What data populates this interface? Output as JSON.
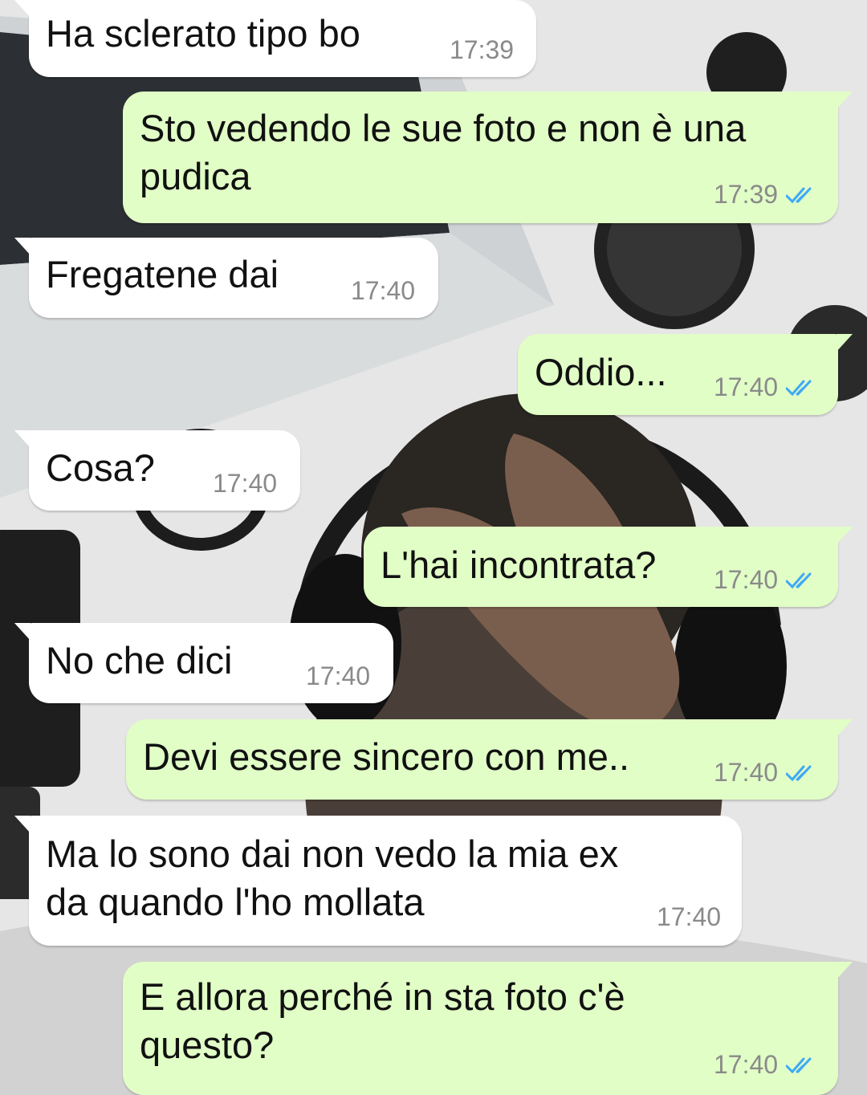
{
  "chat": {
    "messages": [
      {
        "direction": "incoming",
        "text": "Ha sclerato tipo bo",
        "time": "17:39"
      },
      {
        "direction": "outgoing",
        "text": "Sto vedendo le sue foto e non è una\npudica",
        "time": "17:39",
        "read": true
      },
      {
        "direction": "incoming",
        "text": "Fregatene dai",
        "time": "17:40"
      },
      {
        "direction": "outgoing",
        "text": "Oddio...",
        "time": "17:40",
        "read": true
      },
      {
        "direction": "incoming",
        "text": "Cosa?",
        "time": "17:40"
      },
      {
        "direction": "outgoing",
        "text": "L'hai incontrata?",
        "time": "17:40",
        "read": true
      },
      {
        "direction": "incoming",
        "text": "No che dici",
        "time": "17:40"
      },
      {
        "direction": "outgoing",
        "text": "Devi essere sincero con me..",
        "time": "17:40",
        "read": true
      },
      {
        "direction": "incoming",
        "text": "Ma lo sono dai non vedo la mia ex\nda quando l'ho mollata",
        "time": "17:40"
      },
      {
        "direction": "outgoing",
        "text": "E allora perché in sta foto c'è\nquesto?",
        "time": "17:40",
        "read": true
      }
    ]
  },
  "colors": {
    "incoming_bubble": "#ffffff",
    "outgoing_bubble": "#e1fec6",
    "read_ticks": "#3fa9f5",
    "timestamp": "#8a8a8a"
  },
  "icons": {
    "read_receipt": "double-check-icon"
  }
}
